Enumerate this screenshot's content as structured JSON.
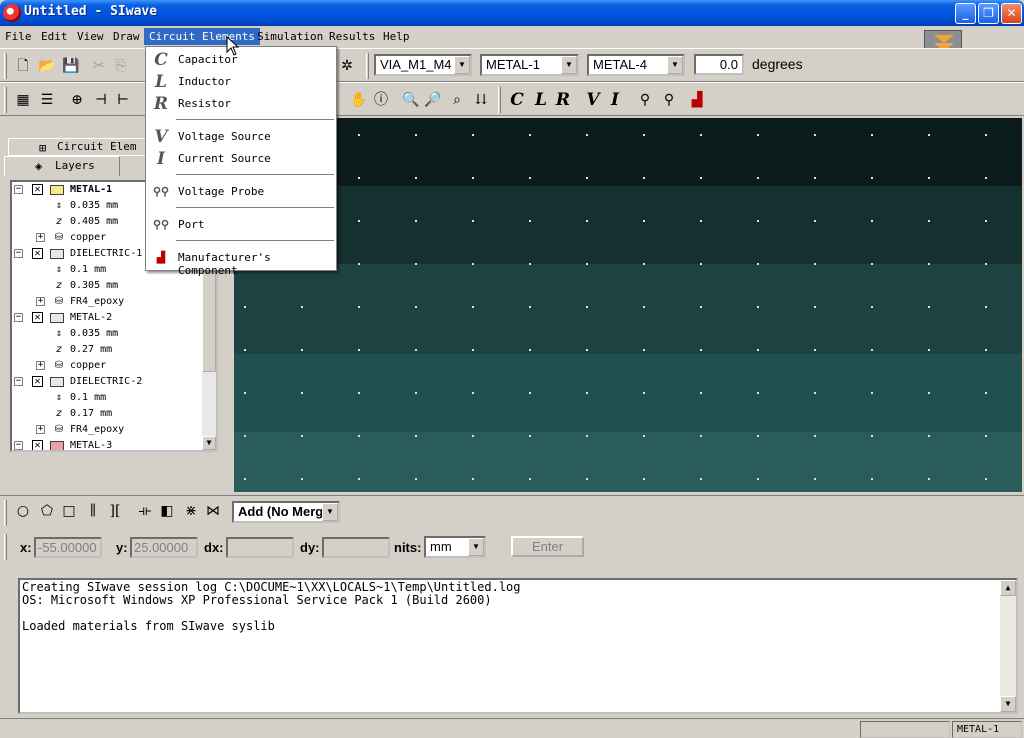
{
  "window": {
    "title": "Untitled - SIwave",
    "controls": {
      "minimize": "_",
      "maximize": "❐",
      "close": "✕"
    }
  },
  "menubar": {
    "items": [
      "File",
      "Edit",
      "View",
      "Draw",
      "Circuit Elements",
      "Simulation",
      "Results",
      "Help"
    ],
    "active": "Circuit Elements"
  },
  "toolbar_top": {
    "via_select": "VIA_M1_M4",
    "layer_from": "METAL-1",
    "layer_to": "METAL-4",
    "angle_value": "0.0",
    "angle_units": "degrees"
  },
  "circuit_menu": {
    "items": [
      {
        "icon": "C",
        "label": "Capacitor"
      },
      {
        "icon": "L",
        "label": "Inductor"
      },
      {
        "icon": "R",
        "label": "Resistor"
      },
      {
        "icon": "V",
        "label": "Voltage Source"
      },
      {
        "icon": "I",
        "label": "Current Source"
      },
      {
        "icon": "probe-icon",
        "label": "Voltage Probe"
      },
      {
        "icon": "port-icon",
        "label": "Port"
      },
      {
        "icon": "component-icon",
        "label": "Manufacturer's Component"
      }
    ]
  },
  "left_panel": {
    "tab_circuit": "Circuit Elem",
    "tab_layers": "Layers",
    "tree": [
      {
        "kind": "layer",
        "label": "METAL-1",
        "checked": "✕",
        "swatch": "#f5e98a",
        "bold": true
      },
      {
        "kind": "thickness",
        "label": "0.035 mm"
      },
      {
        "kind": "z",
        "label": "0.405 mm"
      },
      {
        "kind": "material",
        "label": "copper"
      },
      {
        "kind": "layer",
        "label": "DIELECTRIC-1",
        "checked": "✕",
        "swatch": "#e8e8e8"
      },
      {
        "kind": "thickness",
        "label": "0.1 mm"
      },
      {
        "kind": "z",
        "label": "0.305 mm"
      },
      {
        "kind": "material",
        "label": "FR4_epoxy"
      },
      {
        "kind": "layer",
        "label": "METAL-2",
        "checked": "✕",
        "swatch": "#e8e8e8"
      },
      {
        "kind": "thickness",
        "label": "0.035 mm"
      },
      {
        "kind": "z",
        "label": "0.27 mm"
      },
      {
        "kind": "material",
        "label": "copper"
      },
      {
        "kind": "layer",
        "label": "DIELECTRIC-2",
        "checked": "✕",
        "swatch": "#e8e8e8"
      },
      {
        "kind": "thickness",
        "label": "0.1 mm"
      },
      {
        "kind": "z",
        "label": "0.17 mm"
      },
      {
        "kind": "material",
        "label": "FR4_epoxy"
      },
      {
        "kind": "layer",
        "label": "METAL-3",
        "checked": "✕",
        "swatch": "#f0a0a0"
      }
    ]
  },
  "canvas": {
    "band_colors": [
      "#0b1b1c",
      "#14302f",
      "#1d4241",
      "#22504e",
      "#2a5c5b"
    ]
  },
  "toolbar_bottom": {
    "merge_mode": "Add (No Merg"
  },
  "coords": {
    "x_label": "x:",
    "x_value": "-55.00000",
    "y_label": "y:",
    "y_value": "25.00000",
    "dx_label": "dx:",
    "dx_value": "",
    "dy_label": "dy:",
    "dy_value": "",
    "units_label": "nits:",
    "units_value": "mm",
    "enter_label": "Enter"
  },
  "log": {
    "lines": [
      "Creating SIwave session log C:\\DOCUME~1\\XX\\LOCALS~1\\Temp\\Untitled.log",
      "OS: Microsoft Windows XP Professional Service Pack 1 (Build 2600)",
      "",
      "Loaded materials from SIwave syslib"
    ]
  },
  "statusbar": {
    "layer": "METAL-1"
  }
}
